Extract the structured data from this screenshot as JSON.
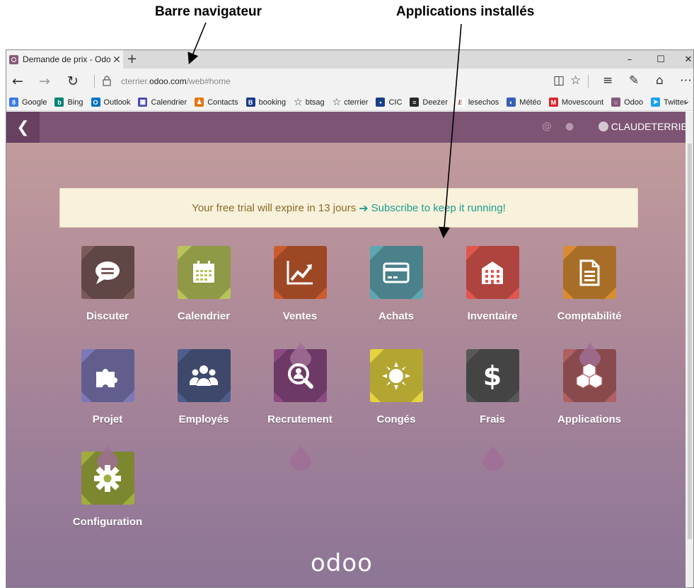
{
  "annotations": {
    "left": "Barre navigateur",
    "right": "Applications installés"
  },
  "browser": {
    "tab_title": "Demande de prix - Odo",
    "close_glyph": "✕",
    "new_tab_glyph": "+",
    "window_controls": {
      "minimize": "–",
      "maximize": "☐",
      "close": "✕"
    },
    "url_prefix": "cterrier.",
    "url_domain": "odoo.com",
    "url_path": "/web#home",
    "bookmarks": [
      {
        "label": "Google",
        "icon": "google-icon",
        "color": "#3b78e7",
        "glyph": "8"
      },
      {
        "label": "Bing",
        "icon": "bing-icon",
        "color": "#008373",
        "glyph": "b"
      },
      {
        "label": "Outlook",
        "icon": "outlook-icon",
        "color": "#0072c6",
        "glyph": "O"
      },
      {
        "label": "Calendrier",
        "icon": "calendar-icon",
        "color": "#4a4ab5",
        "glyph": "▦"
      },
      {
        "label": "Contacts",
        "icon": "contacts-icon",
        "color": "#e8730e",
        "glyph": "♟"
      },
      {
        "label": "booking",
        "icon": "booking-icon",
        "color": "#1b3a8a",
        "glyph": "B"
      },
      {
        "label": "btsag",
        "icon": "star-icon",
        "color": "",
        "glyph": "☆"
      },
      {
        "label": "cterrier",
        "icon": "star-icon",
        "color": "",
        "glyph": "☆"
      },
      {
        "label": "CIC",
        "icon": "cic-icon",
        "color": "#1b3f86",
        "glyph": "▪"
      },
      {
        "label": "Deezer",
        "icon": "deezer-icon",
        "color": "#2a2a2a",
        "glyph": "≡"
      },
      {
        "label": "lesechos",
        "icon": "lesechos-icon",
        "color": "#ffffff",
        "glyph": "E"
      },
      {
        "label": "Météo",
        "icon": "meteo-icon",
        "color": "#3a5fb5",
        "glyph": "◐"
      },
      {
        "label": "Movescount",
        "icon": "movescount-icon",
        "color": "#d6262c",
        "glyph": "M"
      },
      {
        "label": "Odoo",
        "icon": "odoo-icon",
        "color": "#875a7b",
        "glyph": "○"
      },
      {
        "label": "Twitter",
        "icon": "twitter-icon",
        "color": "#1da1f2",
        "glyph": "➤"
      }
    ]
  },
  "odoo": {
    "back_glyph": "❮",
    "username": "CLAUDETERRIER",
    "trial_text": "Your free trial will expire in 13 jours",
    "trial_link": "Subscribe to keep it running!",
    "logo": "odoo",
    "apps": [
      {
        "name": "Discuter",
        "color": "#7d5a5a",
        "icon": "chat-icon"
      },
      {
        "name": "Calendrier",
        "color": "#b8c45a",
        "icon": "calendar-icon"
      },
      {
        "name": "Ventes",
        "color": "#cb5c2f",
        "icon": "chart-up-icon"
      },
      {
        "name": "Achats",
        "color": "#5fa6b3",
        "icon": "credit-card-icon"
      },
      {
        "name": "Inventaire",
        "color": "#e0574f",
        "icon": "building-icon"
      },
      {
        "name": "Comptabilité",
        "color": "#d88d32",
        "icon": "document-icon"
      },
      {
        "name": "Projet",
        "color": "#7d79b7",
        "icon": "puzzle-icon"
      },
      {
        "name": "Employés",
        "color": "#4f5d89",
        "icon": "users-icon"
      },
      {
        "name": "Recrutement",
        "color": "#8c4a83",
        "icon": "search-person-icon"
      },
      {
        "name": "Congés",
        "color": "#e5d43f",
        "icon": "sun-icon"
      },
      {
        "name": "Frais",
        "color": "#585858",
        "icon": "dollar-icon"
      },
      {
        "name": "Applications",
        "color": "#b05f63",
        "icon": "cubes-icon"
      },
      {
        "name": "Configuration",
        "color": "#9fad3e",
        "icon": "gear-icon"
      }
    ]
  }
}
